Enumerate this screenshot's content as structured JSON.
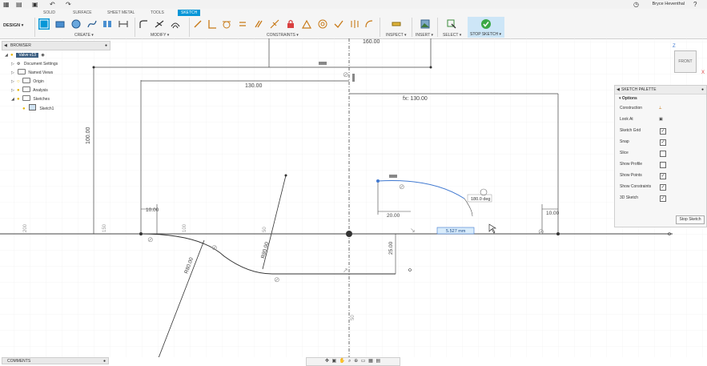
{
  "user": {
    "name": "Bryce Heventhal"
  },
  "tabs": [
    "SOLID",
    "SURFACE",
    "SHEET METAL",
    "TOOLS",
    "SKETCH"
  ],
  "active_tab": "SKETCH",
  "workspace": "DESIGN",
  "groups": {
    "create": "CREATE",
    "modify": "MODIFY",
    "constraints": "CONSTRAINTS",
    "inspect": "INSPECT",
    "insert": "INSERT",
    "select": "SELECT",
    "stop": "STOP SKETCH"
  },
  "browser": {
    "title": "BROWSER",
    "root": "Valve v13",
    "items": [
      "Document Settings",
      "Named Views",
      "Origin",
      "Analysis",
      "Sketches",
      "Sketch1"
    ]
  },
  "palette": {
    "title": "SKETCH PALETTE",
    "section": "Options",
    "rows": [
      {
        "label": "Construction",
        "kind": "icon"
      },
      {
        "label": "Look At",
        "kind": "icon"
      },
      {
        "label": "Sketch Grid",
        "kind": "check"
      },
      {
        "label": "Snap",
        "kind": "check"
      },
      {
        "label": "Slice",
        "kind": "empty"
      },
      {
        "label": "Show Profile",
        "kind": "empty"
      },
      {
        "label": "Show Points",
        "kind": "check"
      },
      {
        "label": "Show Constraints",
        "kind": "check"
      },
      {
        "label": "3D Sketch",
        "kind": "check"
      }
    ],
    "button": "Stop Sketch"
  },
  "viewcube": {
    "face": "FRONT",
    "axis_z": "Z",
    "axis_x": "X"
  },
  "comments": "COMMENTS",
  "dimensions": {
    "top": "160.00",
    "left_width": "130.00",
    "right_width": "fx: 130.00",
    "height": "100.00",
    "left_small": "10.00",
    "right_small": "10.00",
    "arc_offset": "20.00",
    "angle": "180.0 deg",
    "live_input": "5.527 mm",
    "radius_a": "R80.00",
    "radius_b": "R80.00",
    "drop": "25.00",
    "axis_150": "150",
    "axis_100": "100",
    "axis_50": "50",
    "axis_200": "200",
    "axis_50_bottom": "50"
  }
}
